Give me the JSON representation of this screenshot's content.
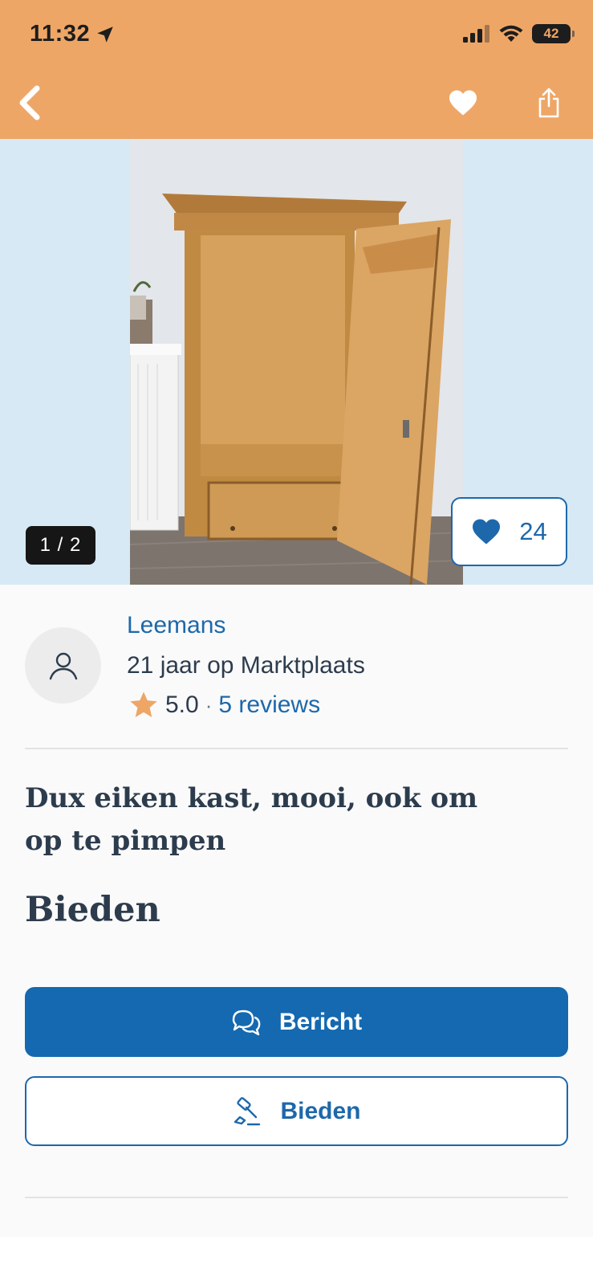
{
  "status_bar": {
    "time": "11:32",
    "battery": "42"
  },
  "header": {
    "back_icon": "chevron-left-icon",
    "favorite_icon": "heart-icon",
    "share_icon": "share-icon",
    "background_color": "#eea666"
  },
  "gallery": {
    "counter": "1 / 2",
    "favorites_count": "24"
  },
  "seller": {
    "name": "Leemans",
    "member_since": "21 jaar op Marktplaats",
    "rating": "5.0",
    "separator": "·",
    "reviews": "5 reviews"
  },
  "listing": {
    "title": "Dux eiken kast, mooi, ook om op te pimpen",
    "price": "Bieden"
  },
  "actions": {
    "message_label": "Bericht",
    "bid_label": "Bieden",
    "accent_color": "#1469b0"
  }
}
